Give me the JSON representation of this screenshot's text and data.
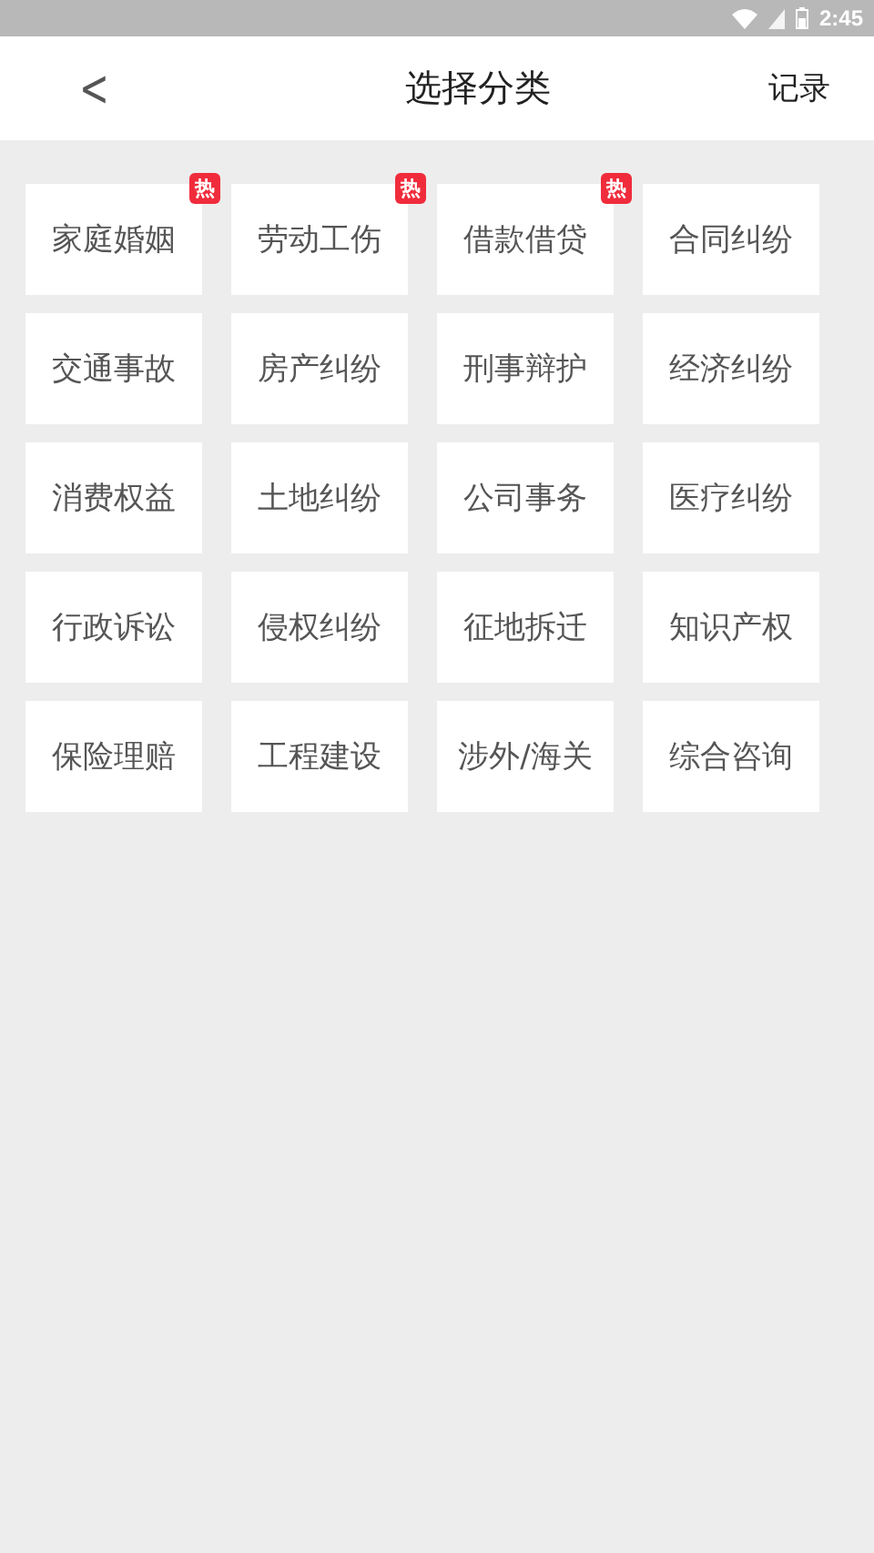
{
  "status_bar": {
    "time": "2:45"
  },
  "header": {
    "back": "<",
    "title": "选择分类",
    "action": "记录"
  },
  "categories": [
    {
      "label": "家庭婚姻",
      "badge": "热"
    },
    {
      "label": "劳动工伤",
      "badge": "热"
    },
    {
      "label": "借款借贷",
      "badge": "热"
    },
    {
      "label": "合同纠纷"
    },
    {
      "label": "交通事故"
    },
    {
      "label": "房产纠纷"
    },
    {
      "label": "刑事辩护"
    },
    {
      "label": "经济纠纷"
    },
    {
      "label": "消费权益"
    },
    {
      "label": "土地纠纷"
    },
    {
      "label": "公司事务"
    },
    {
      "label": "医疗纠纷"
    },
    {
      "label": "行政诉讼"
    },
    {
      "label": "侵权纠纷"
    },
    {
      "label": "征地拆迁"
    },
    {
      "label": "知识产权"
    },
    {
      "label": "保险理赔"
    },
    {
      "label": "工程建设"
    },
    {
      "label": "涉外/海关"
    },
    {
      "label": "综合咨询"
    }
  ]
}
